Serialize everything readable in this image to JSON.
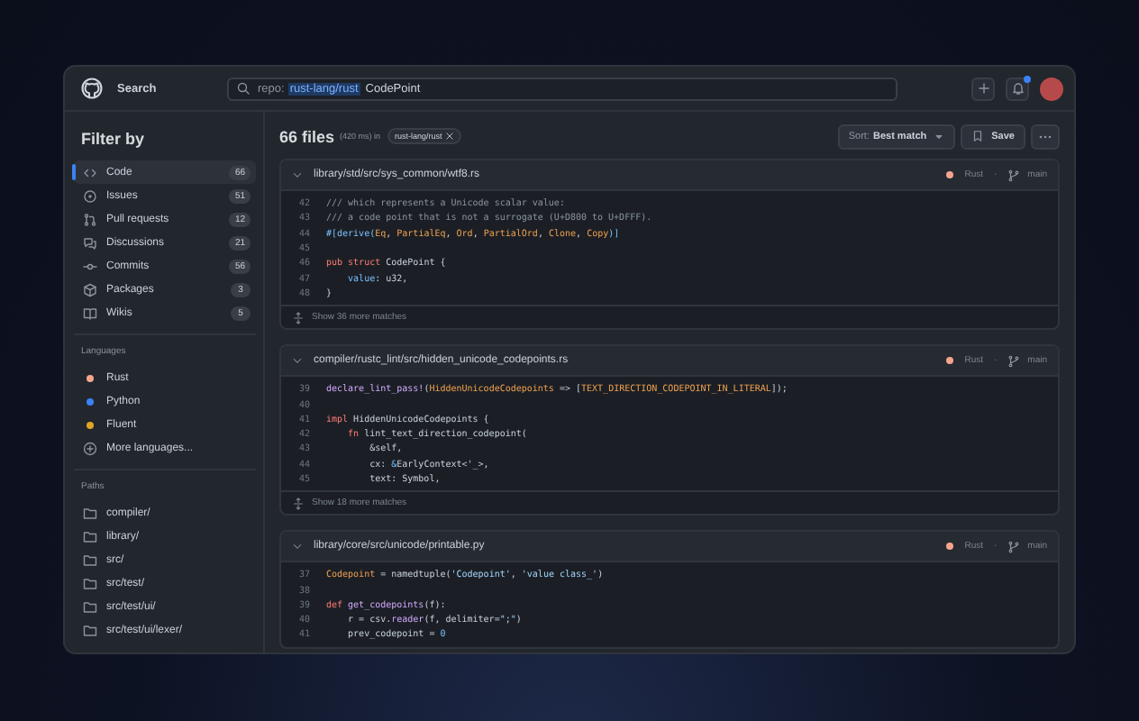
{
  "header": {
    "title": "Search",
    "search": {
      "qualifier": "repo:",
      "repo": "rust-lang/rust",
      "term": "CodePoint"
    },
    "notifications_unread": true
  },
  "sidebar": {
    "title": "Filter by",
    "types": [
      {
        "label": "Code",
        "count": "66",
        "selected": true
      },
      {
        "label": "Issues",
        "count": "51",
        "selected": false
      },
      {
        "label": "Pull requests",
        "count": "12",
        "selected": false
      },
      {
        "label": "Discussions",
        "count": "21",
        "selected": false
      },
      {
        "label": "Commits",
        "count": "56",
        "selected": false
      },
      {
        "label": "Packages",
        "count": "3",
        "selected": false
      },
      {
        "label": "Wikis",
        "count": "5",
        "selected": false
      }
    ],
    "languages": {
      "heading": "Languages",
      "items": [
        {
          "name": "Rust",
          "color": "#f5a58e"
        },
        {
          "name": "Python",
          "color": "#3b82f6"
        },
        {
          "name": "Fluent",
          "color": "#e0a526"
        }
      ],
      "more": "More languages..."
    },
    "paths": {
      "heading": "Paths",
      "items": [
        "compiler/",
        "library/",
        "src/",
        "src/test/",
        "src/test/ui/",
        "src/test/ui/lexer/"
      ]
    }
  },
  "results_bar": {
    "count": "66 files",
    "timing": "(420 ms) in",
    "scope": "rust-lang/rust",
    "sort_label": "Sort:",
    "sort_value": "Best match",
    "save": "Save"
  },
  "results": [
    {
      "path": "library/std/src/sys_common/wtf8.rs",
      "language": "Rust",
      "color": "#f5a58e",
      "separator": "·",
      "branch": "main",
      "more": "Show 36 more matches",
      "lines": [
        {
          "number": "42",
          "tokens": [
            {
              "text": "/// which represents a Unicode scalar value:",
              "kind": "comment"
            }
          ]
        },
        {
          "number": "43",
          "tokens": [
            {
              "text": "/// a code point that is not a surrogate (U+D800 to U+DFFF).",
              "kind": "comment"
            }
          ]
        },
        {
          "number": "44",
          "tokens": [
            {
              "text": "#[derive(",
              "kind": "attr"
            },
            {
              "text": "Eq",
              "kind": "type"
            },
            {
              "text": ", ",
              "kind": "plain"
            },
            {
              "text": "PartialEq",
              "kind": "type"
            },
            {
              "text": ", ",
              "kind": "plain"
            },
            {
              "text": "Ord",
              "kind": "type"
            },
            {
              "text": ", ",
              "kind": "plain"
            },
            {
              "text": "PartialOrd",
              "kind": "type"
            },
            {
              "text": ", ",
              "kind": "plain"
            },
            {
              "text": "Clone",
              "kind": "type"
            },
            {
              "text": ", ",
              "kind": "plain"
            },
            {
              "text": "Copy",
              "kind": "type"
            },
            {
              "text": ")]",
              "kind": "attr"
            }
          ]
        },
        {
          "number": "45"
        },
        {
          "number": "46",
          "tokens": [
            {
              "text": "pub struct",
              "kind": "keyword"
            },
            {
              "text": " CodePoint {",
              "kind": "plain"
            }
          ]
        },
        {
          "number": "47",
          "tokens": [
            {
              "text": "    value",
              "kind": "attr"
            },
            {
              "text": ": u32,",
              "kind": "plain"
            }
          ]
        },
        {
          "number": "48",
          "tokens": [
            {
              "text": "}",
              "kind": "plain"
            }
          ]
        }
      ]
    },
    {
      "path": "compiler/rustc_lint/src/hidden_unicode_codepoints.rs",
      "language": "Rust",
      "color": "#f5a58e",
      "separator": "·",
      "branch": "main",
      "more": "Show 18 more matches",
      "lines": [
        {
          "number": "39",
          "tokens": [
            {
              "text": "declare_lint_pass!",
              "kind": "func"
            },
            {
              "text": "(",
              "kind": "plain"
            },
            {
              "text": "HiddenUnicodeCodepoints",
              "kind": "type"
            },
            {
              "text": " => [",
              "kind": "plain"
            },
            {
              "text": "TEXT_DIRECTION_CODEPOINT_IN_LITERAL",
              "kind": "type"
            },
            {
              "text": "]);",
              "kind": "plain"
            }
          ]
        },
        {
          "number": "40"
        },
        {
          "number": "41",
          "tokens": [
            {
              "text": "impl",
              "kind": "keyword"
            },
            {
              "text": " HiddenUnicodeCodepoints {",
              "kind": "plain"
            }
          ]
        },
        {
          "number": "42",
          "tokens": [
            {
              "text": "    fn",
              "kind": "keyword"
            },
            {
              "text": " lint_text_direction_codepoint(",
              "kind": "plain"
            }
          ]
        },
        {
          "number": "43",
          "tokens": [
            {
              "text": "        &self,",
              "kind": "plain"
            }
          ]
        },
        {
          "number": "44",
          "tokens": [
            {
              "text": "        cx: ",
              "kind": "plain"
            },
            {
              "text": "&",
              "kind": "attr"
            },
            {
              "text": "EarlyContext<'_>,",
              "kind": "plain"
            }
          ]
        },
        {
          "number": "45",
          "tokens": [
            {
              "text": "        text: Symbol,",
              "kind": "plain"
            }
          ]
        }
      ]
    },
    {
      "path": "library/core/src/unicode/printable.py",
      "language": "Rust",
      "color": "#f5a58e",
      "separator": "·",
      "branch": "main",
      "lines": [
        {
          "number": "37",
          "tokens": [
            {
              "text": "Codepoint",
              "kind": "type"
            },
            {
              "text": " = namedtuple(",
              "kind": "plain"
            },
            {
              "text": "'Codepoint'",
              "kind": "string"
            },
            {
              "text": ", ",
              "kind": "plain"
            },
            {
              "text": "'value class_'",
              "kind": "string"
            },
            {
              "text": ")",
              "kind": "plain"
            }
          ]
        },
        {
          "number": "38"
        },
        {
          "number": "39",
          "tokens": [
            {
              "text": "def",
              "kind": "keyword"
            },
            {
              "text": " get_codepoints",
              "kind": "func"
            },
            {
              "text": "(f):",
              "kind": "plain"
            }
          ]
        },
        {
          "number": "40",
          "tokens": [
            {
              "text": "    r = csv.",
              "kind": "plain"
            },
            {
              "text": "reader",
              "kind": "func"
            },
            {
              "text": "(f, delimiter=",
              "kind": "plain"
            },
            {
              "text": "\";\"",
              "kind": "string"
            },
            {
              "text": ")",
              "kind": "plain"
            }
          ]
        },
        {
          "number": "41",
          "tokens": [
            {
              "text": "    prev_codepoint = ",
              "kind": "plain"
            },
            {
              "text": "0",
              "kind": "attr"
            }
          ]
        }
      ]
    }
  ]
}
